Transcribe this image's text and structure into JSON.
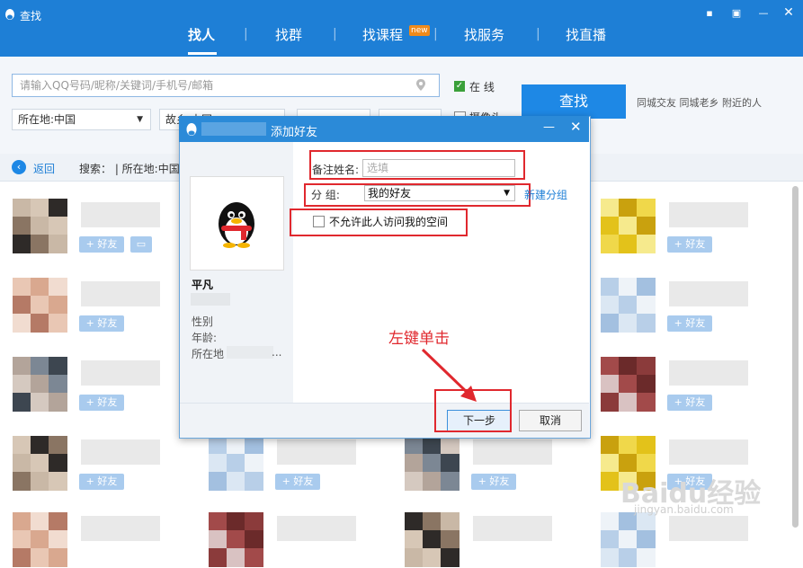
{
  "app": {
    "title": "查找"
  },
  "nav": {
    "tabs": [
      {
        "label": "找人"
      },
      {
        "label": "找群"
      },
      {
        "label": "找课程",
        "badge": "new"
      },
      {
        "label": "找服务"
      },
      {
        "label": "找直播"
      }
    ]
  },
  "search": {
    "placeholder": "请输入QQ号码/昵称/关键词/手机号/邮箱",
    "online_label": "在  线",
    "online_checked": true,
    "button_label": "查找",
    "location_value": "所在地:中国",
    "hometown_value": "故乡:中国",
    "camera_label": "摄像头",
    "shortcuts": [
      "同城交友",
      "同城老乡",
      "附近的人"
    ]
  },
  "breadcrumb": {
    "back_label": "返回",
    "text": "搜索： | 所在地:中国"
  },
  "results": {
    "add_label": "+ 好友",
    "msg_label": "▭"
  },
  "dialog": {
    "title": "添加好友",
    "profile": {
      "name": "平凡",
      "gender_label": "性别",
      "age_label": "年龄:",
      "location_label": "所在地",
      "ellipsis": "..."
    },
    "remark_label": "备注姓名:",
    "remark_placeholder": "选填",
    "group_label": "分      组:",
    "group_value": "我的好友",
    "new_group_link": "新建分组",
    "privacy_label": "不允许此人访问我的空间",
    "privacy_checked": false,
    "next_button": "下一步",
    "cancel_button": "取消"
  },
  "annotation": {
    "text": "左键单击"
  },
  "watermark": {
    "text": "Baidu经验",
    "sub": "jingyan.baidu.com"
  },
  "colors": {
    "brand_blue": "#1e7fd6",
    "button_blue": "#1e88e5",
    "annotation_red": "#e0282e",
    "online_green": "#3aa03a"
  }
}
